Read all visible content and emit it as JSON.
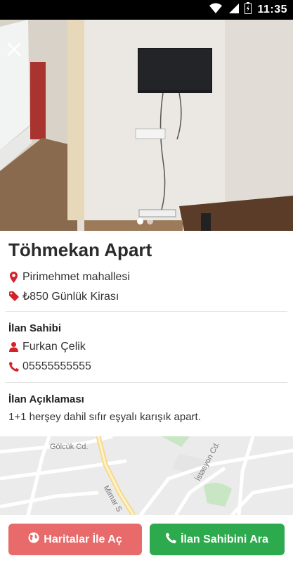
{
  "status_bar": {
    "time": "11:35"
  },
  "listing": {
    "title": "Töhmekan Apart",
    "location": "Pirimehmet mahallesi",
    "price": "₺850 Günlük Kirası"
  },
  "owner": {
    "heading": "İlan Sahibi",
    "name": "Furkan Çelik",
    "phone": "05555555555"
  },
  "description": {
    "heading": "İlan Açıklaması",
    "text": "1+1 herşey dahil sıfır eşyalı karışık apart."
  },
  "map": {
    "labels": {
      "street1": "Gölcük Cd.",
      "street2": "İstasyon Cd.",
      "street3": "Mimar S"
    }
  },
  "actions": {
    "maps_label": "Haritalar İle Aç",
    "call_label": "İlan Sahibini Ara"
  },
  "gallery": {
    "slides": 2,
    "active": 1
  },
  "colors": {
    "maps_button": "#e86a6a",
    "call_button": "#2eaa4e",
    "icon_red": "#d3222a"
  }
}
